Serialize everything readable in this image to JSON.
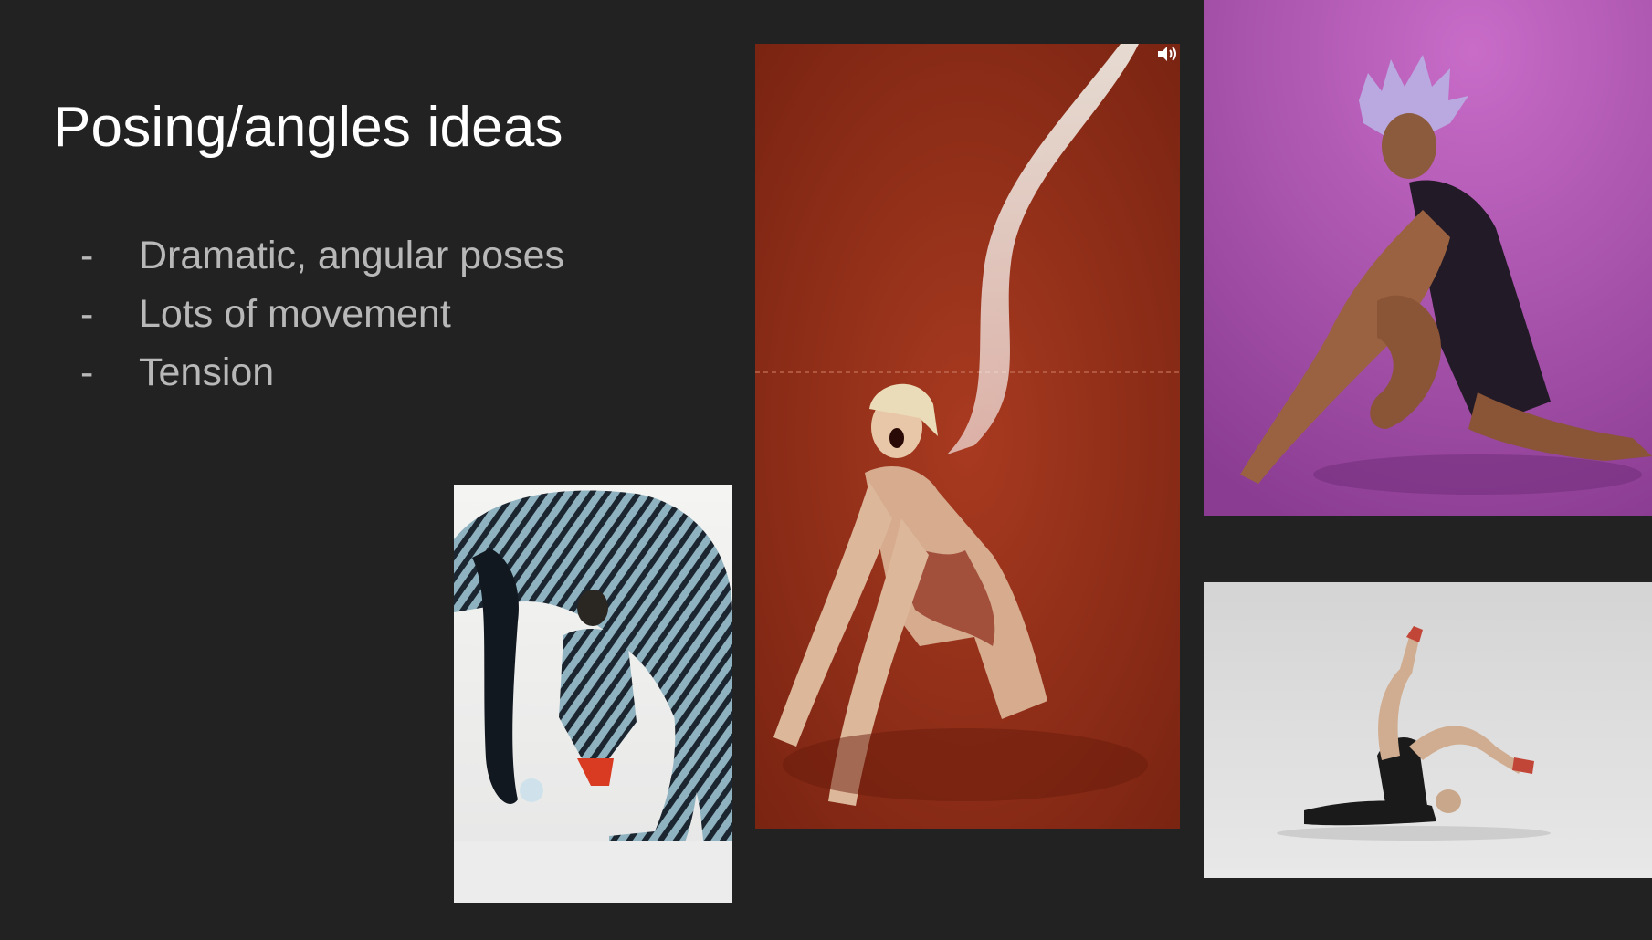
{
  "slide": {
    "title": "Posing/angles ideas",
    "bullets": [
      {
        "marker": "-",
        "text": "Dramatic, angular poses"
      },
      {
        "marker": "-",
        "text": "Lots of movement"
      },
      {
        "marker": "-",
        "text": "Tension"
      }
    ]
  },
  "images": [
    {
      "name": "zebra-contortion-photo",
      "icon": "photo"
    },
    {
      "name": "red-backdrop-veil-photo",
      "icon": "photo"
    },
    {
      "name": "purple-backdrop-seated-photo",
      "icon": "photo"
    },
    {
      "name": "grey-studio-legs-up-photo",
      "icon": "photo"
    }
  ],
  "controls": {
    "audio_icon": "speaker-icon"
  },
  "colors": {
    "background": "#222222",
    "title": "#ffffff",
    "bullet_text": "#b8b8b8"
  }
}
